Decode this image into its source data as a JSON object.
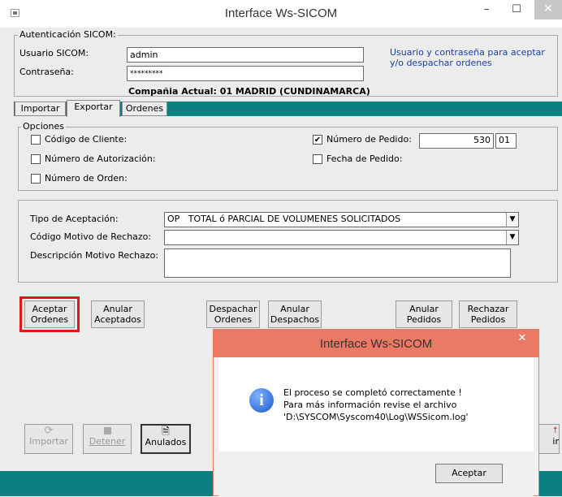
{
  "window": {
    "title": "Interface Ws-SICOM",
    "minimize": "–",
    "maximize": "☐",
    "close": "✕"
  },
  "auth": {
    "group_title": "Autenticación SICOM:",
    "user_label": "Usuario SICOM:",
    "user_value": "admin",
    "password_label": "Contraseña:",
    "password_value": "*********",
    "hint": "Usuario y contraseña para aceptar y/o despachar ordenes",
    "company": "Compañia Actual: 01 MADRID  (CUNDINAMARCA)"
  },
  "tabs": [
    "Importar",
    "Exportar",
    "Ordenes"
  ],
  "options": {
    "group_title": "Opciones",
    "codigo_cliente": "Código de Cliente:",
    "numero_autorizacion": "Número de Autorización:",
    "numero_orden": "Número de Orden:",
    "numero_pedido": "Número de Pedido:",
    "numero_pedido_checked": true,
    "pedido_value": "530",
    "pedido_suffix": "01",
    "fecha_pedido": "Fecha de Pedido:"
  },
  "acceptance": {
    "tipo_label": "Tipo de Aceptación:",
    "tipo_value": "OP   TOTAL ó PARCIAL DE VOLUMENES SOLICITADOS",
    "motivo_label": "Código Motivo de Rechazo:",
    "motivo_value": "",
    "desc_label": "Descripción Motivo Rechazo:",
    "desc_value": ""
  },
  "actions": [
    {
      "line1": "Aceptar",
      "line2": "Ordenes"
    },
    {
      "line1": "Anular",
      "line2": "Aceptados"
    },
    {
      "line1": "Despachar",
      "line2": "Ordenes"
    },
    {
      "line1": "Anular",
      "line2": "Despachos"
    },
    {
      "line1": "Anular",
      "line2": "Pedidos"
    },
    {
      "line1": "Rechazar",
      "line2": "Pedidos"
    }
  ],
  "bottom_buttons": {
    "importar": "Importar",
    "detener": "Detener",
    "anulados": "Anulados",
    "salir": "ir"
  },
  "dialog": {
    "title": "Interface Ws-SICOM",
    "close": "✕",
    "line1": "El proceso se completó correctamente !",
    "line2": "Para más información revise el archivo",
    "line3": "'D:\\SYSCOM\\Syscom40\\Log\\WSSicom.log'",
    "ok": "Aceptar",
    "icon_glyph": "i"
  }
}
